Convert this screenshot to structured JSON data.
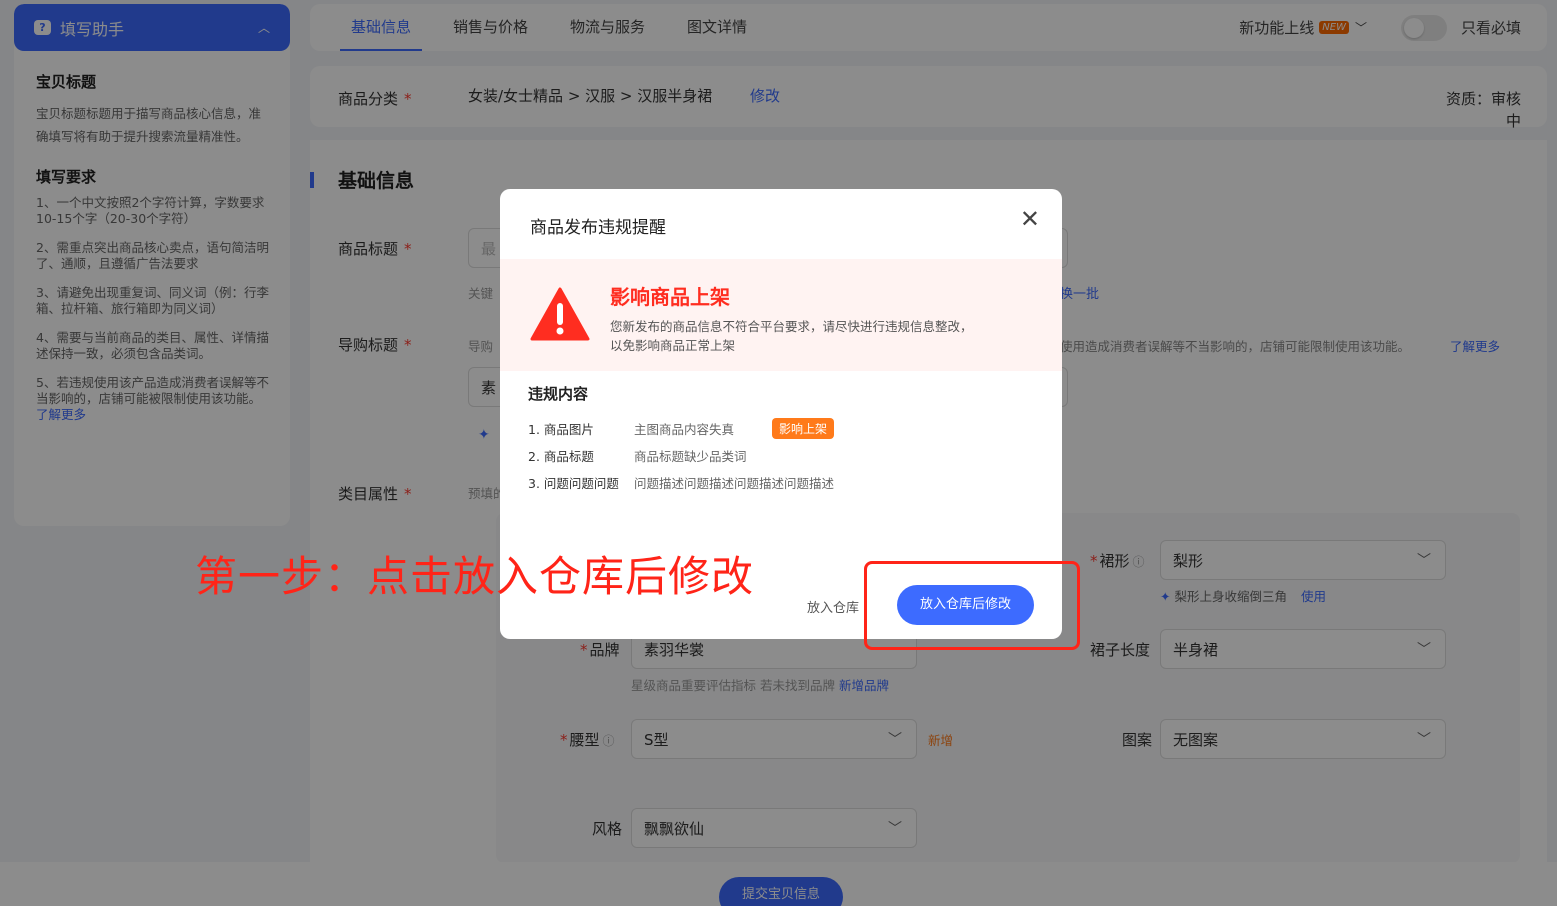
{
  "sidebar": {
    "header_title": "填写助手",
    "section1_title": "宝贝标题",
    "section1_desc": "宝贝标题标题用于描写商品核心信息，准确填写将有助于提升搜索流量精准性。",
    "section2_title": "填写要求",
    "rules": [
      "1、一个中文按照2个字符计算，字数要求10-15个字（20-30个字符）",
      "2、需重点突出商品核心卖点，语句简洁明了、通顺，且遵循广告法要求",
      "3、请避免出现重复词、同义词（例：行李箱、拉杆箱、旅行箱即为同义词）",
      "4、需要与当前商品的类目、属性、详情描述保持一致，必须包含品类词。"
    ],
    "rule5": "5、若违规使用该产品造成消费者误解等不当影响的，店铺可能被限制使用该功能。",
    "learn_more": "了解更多"
  },
  "tabs": {
    "items": [
      "基础信息",
      "销售与价格",
      "物流与服务",
      "图文详情"
    ],
    "new_feature": "新功能上线",
    "new_badge": "NEW",
    "only_required": "只看必填"
  },
  "category": {
    "label": "商品分类",
    "path": "女装/女士精品 > 汉服 > 汉服半身裙",
    "edit": "修改",
    "qualification": "资质：审核中"
  },
  "form": {
    "section_title": "基础信息",
    "title_label": "商品标题",
    "title_placeholder": "最",
    "title_hint": "关键",
    "swap_batch": "换一批",
    "guide_label": "导购标题",
    "guide_hint": "导购",
    "guide_hint_right": "使用造成消费者误解等不当影响的，店铺可能限制使用该功能。",
    "guide_learn": "了解更多",
    "guide_value": "素",
    "attr_label": "类目属性",
    "attr_hint": "预填的",
    "brand_label": "品牌",
    "brand_value": "素羽华裳",
    "brand_hint": "星级商品重要评估指标 若未找到品牌",
    "brand_add": "新增品牌",
    "waist_label": "腰型",
    "waist_value": "S型",
    "waist_new": "新增",
    "style_label": "风格",
    "style_value": "飘飘欲仙",
    "skirt_shape_label": "裙形",
    "skirt_shape_value": "梨形",
    "skirt_shape_hint": "梨形上身收缩倒三角",
    "skirt_shape_use": "使用",
    "skirt_len_label": "裙子长度",
    "skirt_len_value": "半身裙",
    "pattern_label": "图案",
    "pattern_value": "无图案",
    "submit": "提交宝贝信息"
  },
  "modal": {
    "title": "商品发布违规提醒",
    "warn_title": "影响商品上架",
    "warn_desc1": "您新发布的商品信息不符合平台要求，请尽快进行违规信息整改，",
    "warn_desc2": "以免影响商品正常上架",
    "violations_title": "违规内容",
    "violations": [
      {
        "item": "1. 商品图片",
        "desc": "主图商品内容失真",
        "tag": "影响上架"
      },
      {
        "item": "2. 商品标题",
        "desc": "商品标题缺少品类词",
        "tag": ""
      },
      {
        "item": "3. 问题问题问题",
        "desc": "问题描述问题描述问题描述问题描述",
        "tag": ""
      }
    ],
    "btn_store": "放入仓库",
    "btn_store_edit": "放入仓库后修改"
  },
  "annotation": {
    "text": "第一步：点击放入仓库后修改"
  },
  "colors": {
    "primary": "#3d6bff",
    "danger": "#ff2d20",
    "tag_orange": "#ff7a1a"
  }
}
